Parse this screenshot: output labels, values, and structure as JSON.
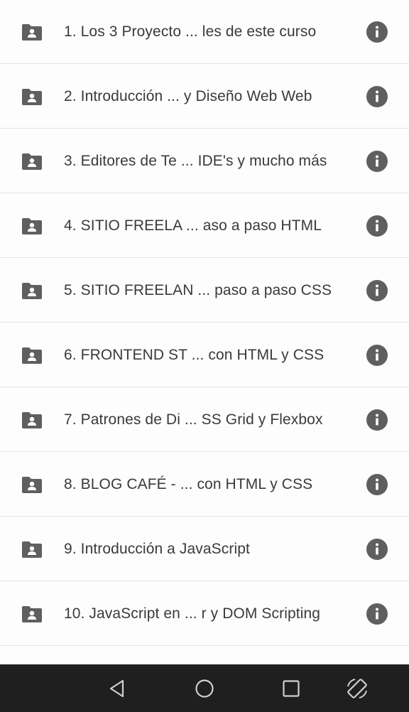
{
  "items": [
    {
      "label": "1. Los 3 Proyecto ... les de este curso",
      "icon": "folder-account-icon",
      "action_icon": "info-icon"
    },
    {
      "label": "2. Introducción ... y Diseño Web Web",
      "icon": "folder-account-icon",
      "action_icon": "info-icon"
    },
    {
      "label": "3. Editores de Te ... IDE's y mucho más",
      "icon": "folder-account-icon",
      "action_icon": "info-icon"
    },
    {
      "label": "4. SITIO FREELA ... aso a paso HTML",
      "icon": "folder-account-icon",
      "action_icon": "info-icon"
    },
    {
      "label": "5. SITIO FREELAN ... paso a paso CSS",
      "icon": "folder-account-icon",
      "action_icon": "info-icon"
    },
    {
      "label": "6. FRONTEND ST ... con HTML y CSS",
      "icon": "folder-account-icon",
      "action_icon": "info-icon"
    },
    {
      "label": "7. Patrones de Di ... SS Grid y Flexbox",
      "icon": "folder-account-icon",
      "action_icon": "info-icon"
    },
    {
      "label": "8. BLOG CAFÉ - ... con HTML y CSS",
      "icon": "folder-account-icon",
      "action_icon": "info-icon"
    },
    {
      "label": "9. Introducción a JavaScript",
      "icon": "folder-account-icon",
      "action_icon": "info-icon"
    },
    {
      "label": "10. JavaScript en ... r y DOM Scripting",
      "icon": "folder-account-icon",
      "action_icon": "info-icon"
    }
  ],
  "nav_bar": {
    "buttons": [
      "back-icon",
      "home-icon",
      "recents-icon",
      "rotate-icon"
    ]
  },
  "colors": {
    "icon": "#5f5f5f",
    "text": "#3a3a3a",
    "divider": "#e3e3e3",
    "nav_background": "#1f1f1f",
    "nav_icon": "#cfcfcf"
  }
}
